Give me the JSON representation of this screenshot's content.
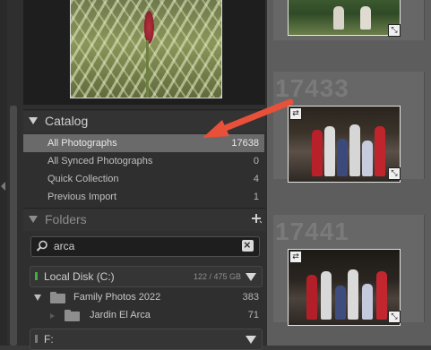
{
  "catalog": {
    "title": "Catalog",
    "items": [
      {
        "label": "All Photographs",
        "count": "17638"
      },
      {
        "label": "All Synced Photographs",
        "count": "0"
      },
      {
        "label": "Quick Collection",
        "count": "4"
      },
      {
        "label": "Previous Import",
        "count": "1"
      }
    ]
  },
  "folders": {
    "title": "Folders",
    "search_value": "arca",
    "volumes": [
      {
        "name": "Local Disk (C:)",
        "size": "122 / 475 GB"
      },
      {
        "name": "F:",
        "size": ""
      }
    ],
    "tree": [
      {
        "label": "Family Photos 2022",
        "count": "383"
      },
      {
        "label": "Jardin El Arca",
        "count": "71"
      }
    ]
  },
  "grid": {
    "cell_indices": [
      "17433",
      "17441"
    ]
  },
  "colors": {
    "selection": "#6a6a6a",
    "arrow": "#e8503a",
    "volume_online": "#3fb03f"
  },
  "icons": [
    "disclosure-triangle-icon",
    "plus-icon",
    "search-icon",
    "clear-icon",
    "folder-icon",
    "sync-badge-icon",
    "edit-badge-icon"
  ]
}
